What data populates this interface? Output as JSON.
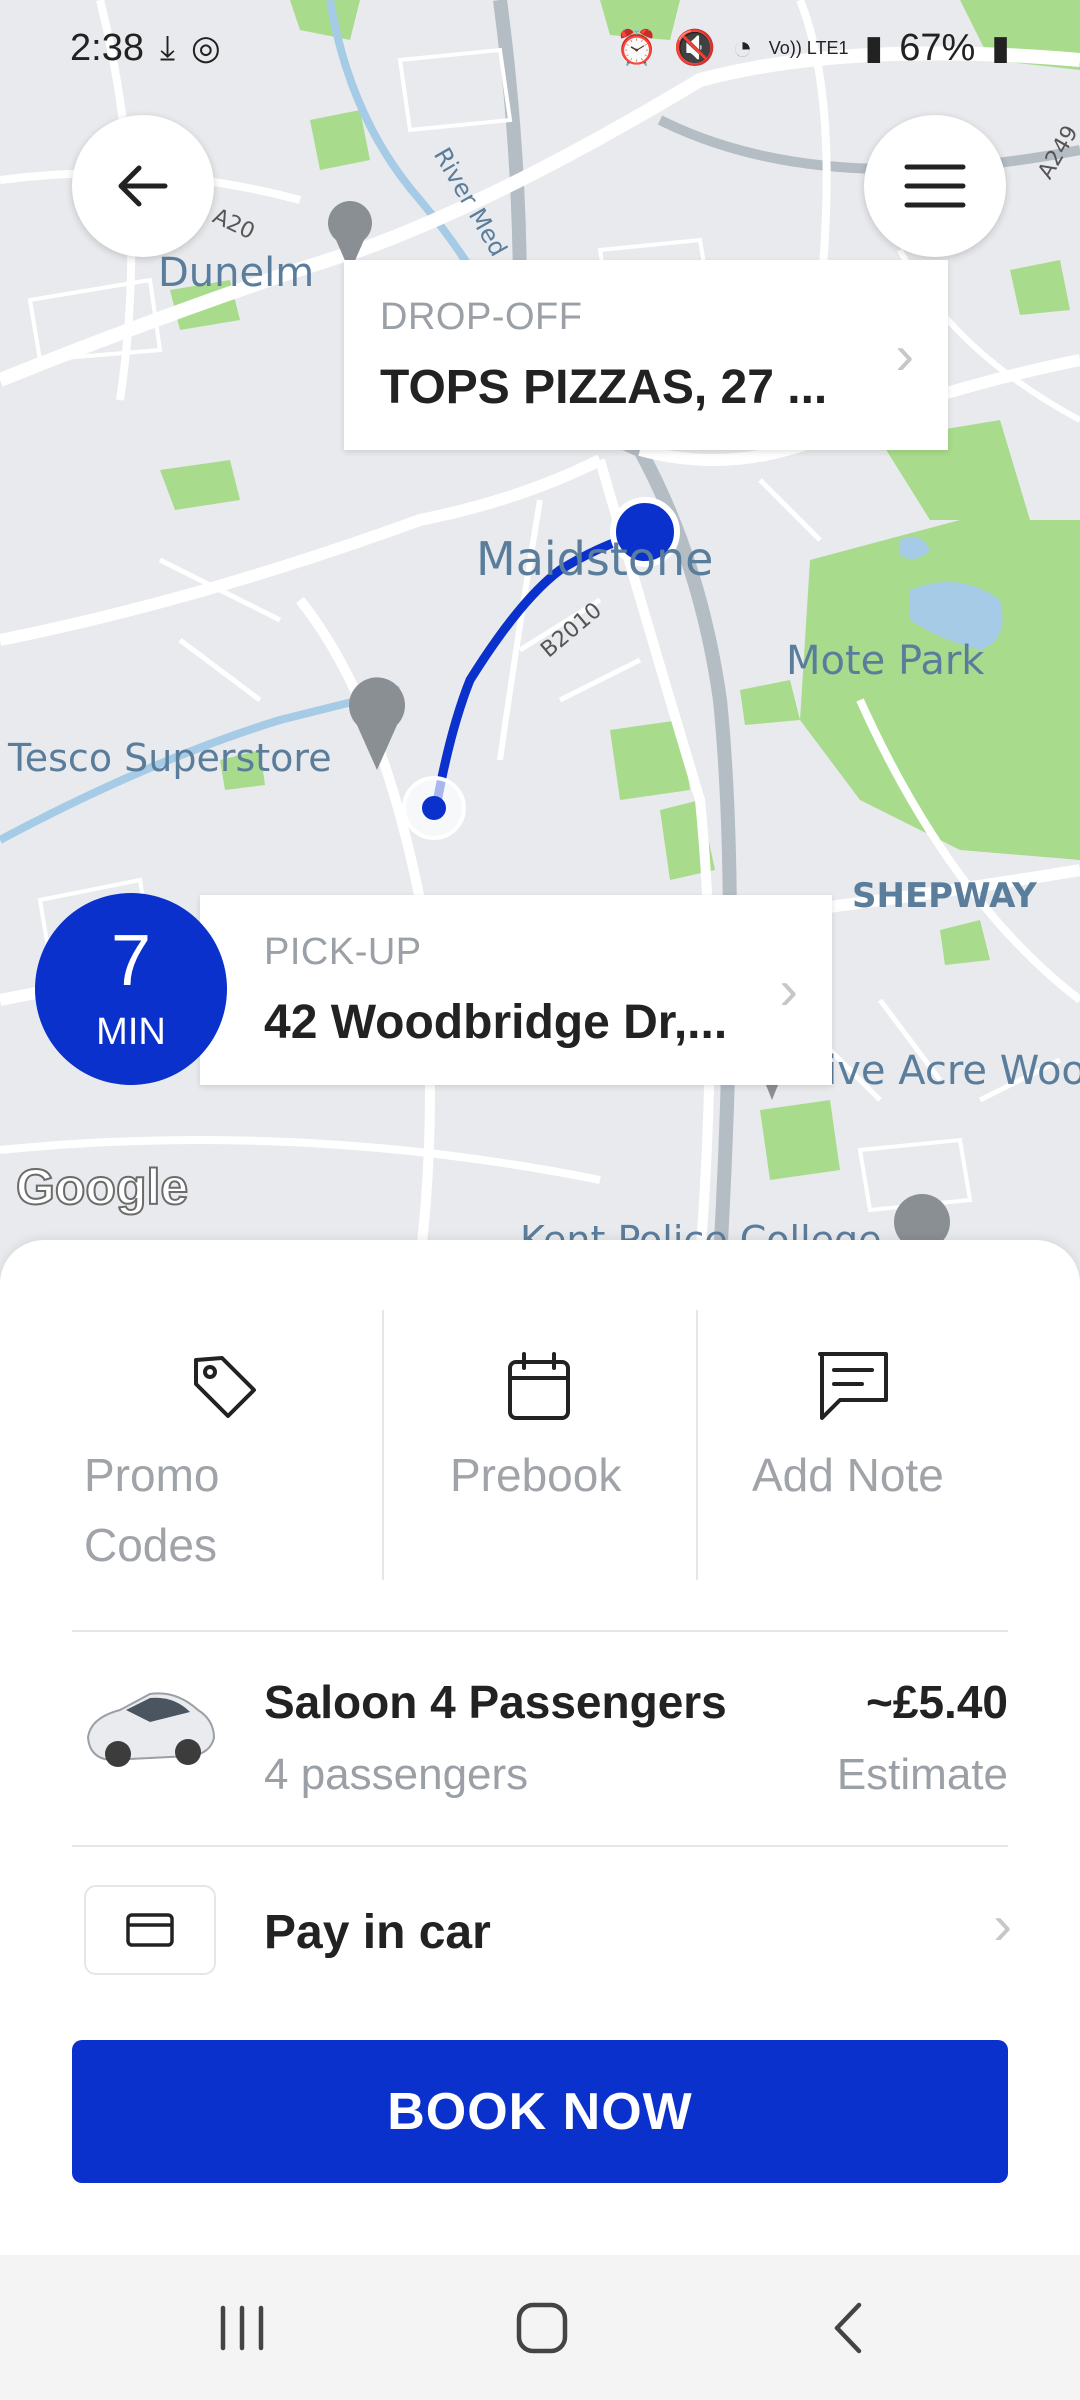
{
  "status_bar": {
    "time": "2:38",
    "battery": "67%",
    "signal_text": "Vo)) LTE1"
  },
  "map": {
    "labels": {
      "dunelm": "Dunelm",
      "maidstone": "Maidstone",
      "mote_park": "Mote Park",
      "tesco": "Tesco Superstore",
      "shepway": "SHEPWAY",
      "five_acre": "Five Acre Wood",
      "kent_police": "Kent Police College",
      "river": "River Med",
      "road_a20": "A20",
      "road_b2010": "B2010",
      "road_a249": "A249"
    },
    "google_logo": "Google"
  },
  "dropoff": {
    "label": "DROP-OFF",
    "value": "TOPS PIZZAS, 27 ..."
  },
  "pickup": {
    "label": "PICK-UP",
    "value": "42 Woodbridge Dr,...",
    "eta_number": "7",
    "eta_unit": "MIN"
  },
  "options": {
    "promo": "Promo Codes",
    "prebook": "Prebook",
    "note": "Add Note"
  },
  "ride": {
    "name": "Saloon 4 Passengers",
    "passengers": "4 passengers",
    "price": "~£5.40",
    "price_note": "Estimate"
  },
  "payment": {
    "label": "Pay in car"
  },
  "book_button": "BOOK NOW",
  "colors": {
    "brand": "#0a31cc",
    "park_green": "#a8dc8c",
    "water": "#a6cbe6"
  }
}
